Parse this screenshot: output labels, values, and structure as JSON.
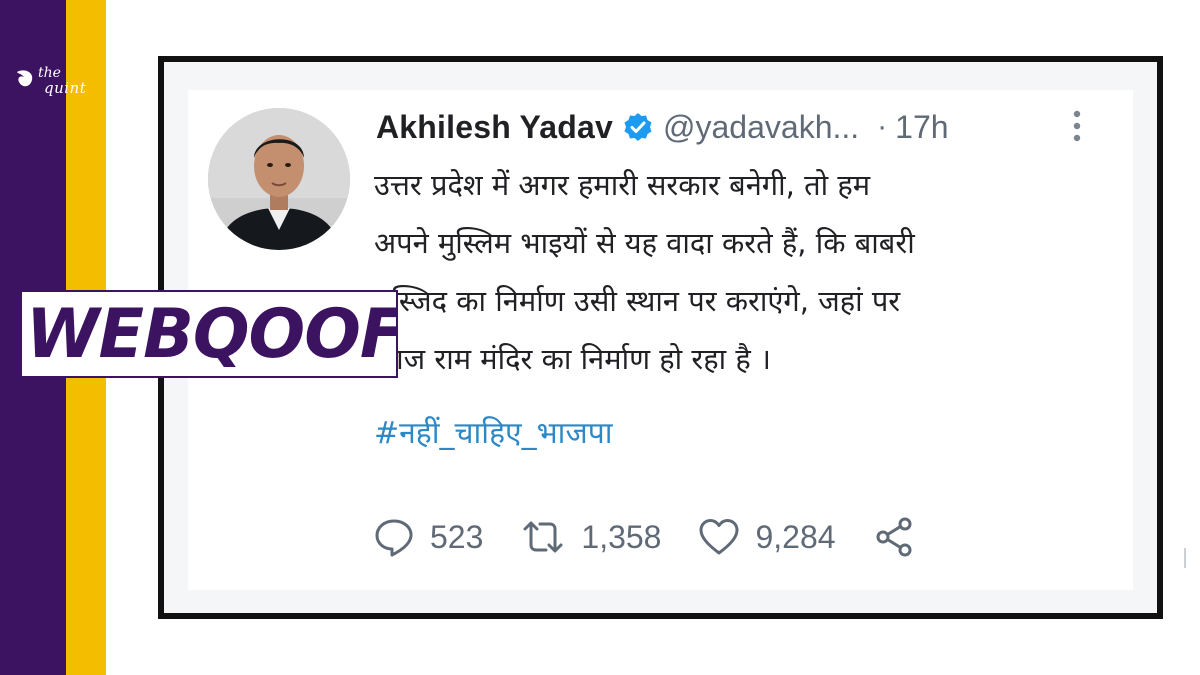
{
  "brand": {
    "line1": "the",
    "line2": "quint",
    "colors": {
      "purple": "#3c1361",
      "yellow": "#f5bd00"
    }
  },
  "banner": {
    "label": "WEBQOOF"
  },
  "tweet": {
    "author": {
      "display_name": "Akhilesh Yadav",
      "verified": true,
      "handle": "@yadavakh...",
      "separator": "·",
      "time": "17h"
    },
    "menu_icon": "more-vertical-icon",
    "body_lines": [
      "उत्तर प्रदेश में अगर हमारी सरकार बनेगी, तो हम",
      "अपने मुस्लिम भाइयों से यह वादा करते हैं, कि बाबरी",
      "मस्जिद का निर्माण उसी स्थान पर कराएंगे, जहां पर",
      "आज राम मंदिर का निर्माण हो रहा है ।"
    ],
    "hashtag": "#नहीं_चाहिए_भाजपा",
    "actions": {
      "reply": {
        "icon": "reply-icon",
        "count": "523"
      },
      "retweet": {
        "icon": "retweet-icon",
        "count": "1,358"
      },
      "like": {
        "icon": "heart-icon",
        "count": "9,284"
      },
      "share": {
        "icon": "share-icon"
      }
    },
    "colors": {
      "text": "#202124",
      "muted": "#5f6a76",
      "link": "#2c88c6",
      "verified": "#1d9bf0"
    }
  }
}
